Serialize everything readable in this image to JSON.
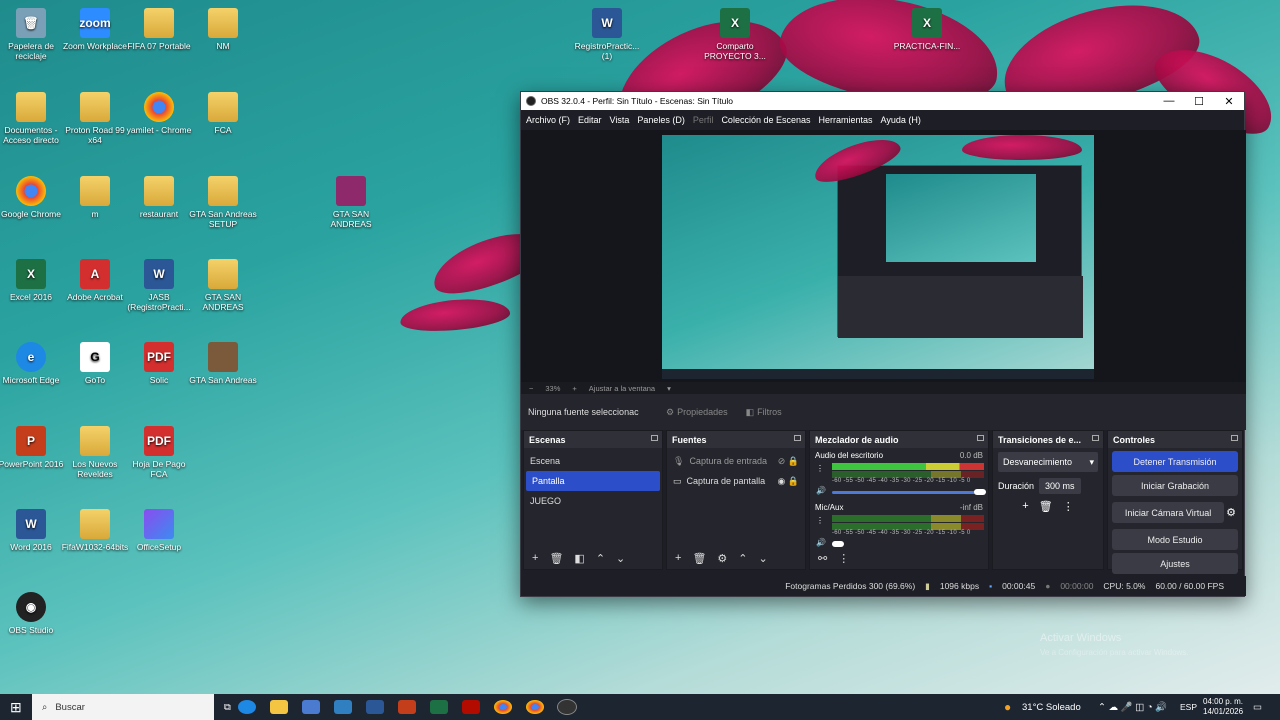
{
  "desktop": {
    "icons": [
      {
        "label": "Papelera de reciclaje",
        "glyph": "🗑",
        "kind": "bin"
      },
      {
        "label": "Zoom Workplace",
        "glyph": "zoom",
        "kind": "zoom"
      },
      {
        "label": "FIFA 07 Portable",
        "glyph": "",
        "kind": "folder"
      },
      {
        "label": "NM",
        "glyph": "",
        "kind": "folder"
      },
      {
        "label": "Documentos - Acceso directo",
        "glyph": "",
        "kind": "folder"
      },
      {
        "label": "Proton Road 99 x64",
        "glyph": "",
        "kind": "folder"
      },
      {
        "label": "yamilet - Chrome",
        "glyph": "",
        "kind": "chrome"
      },
      {
        "label": "FCA",
        "glyph": "",
        "kind": "folder"
      },
      {
        "label": "Google Chrome",
        "glyph": "",
        "kind": "chrome"
      },
      {
        "label": "m",
        "glyph": "",
        "kind": "folder"
      },
      {
        "label": "restaurant",
        "glyph": "",
        "kind": "folder"
      },
      {
        "label": "GTA San Andreas SETUP",
        "glyph": "",
        "kind": "folder"
      },
      {
        "label": "GTA SAN ANDREAS",
        "glyph": "",
        "kind": "rar"
      },
      {
        "label": "Excel 2016",
        "glyph": "X",
        "kind": "xl"
      },
      {
        "label": "Adobe Acrobat",
        "glyph": "A",
        "kind": "pdf"
      },
      {
        "label": "JASB (RegistroPracti...",
        "glyph": "W",
        "kind": "wd"
      },
      {
        "label": "GTA SAN ANDREAS",
        "glyph": "",
        "kind": "folder"
      },
      {
        "label": "Microsoft Edge",
        "glyph": "e",
        "kind": "edge"
      },
      {
        "label": "GoTo",
        "glyph": "G",
        "kind": "goto"
      },
      {
        "label": "Solic",
        "glyph": "PDF",
        "kind": "pdf"
      },
      {
        "label": "GTA San Andreas",
        "glyph": "",
        "kind": "gta"
      },
      {
        "label": "PowerPoint 2016",
        "glyph": "P",
        "kind": "pp"
      },
      {
        "label": "Los Nuevos Reveldes",
        "glyph": "",
        "kind": "folder"
      },
      {
        "label": "Hoja De Pago FCA",
        "glyph": "PDF",
        "kind": "pdf"
      },
      {
        "label": "Word 2016",
        "glyph": "W",
        "kind": "wd"
      },
      {
        "label": "FifaW1032-64bits",
        "glyph": "",
        "kind": "folder"
      },
      {
        "label": "OfficeSetup",
        "glyph": "",
        "kind": "office"
      },
      {
        "label": "OBS Studio",
        "glyph": "◉",
        "kind": "obs"
      },
      {
        "label": "RegistroPractic... (1)",
        "glyph": "W",
        "kind": "wd"
      },
      {
        "label": "Comparto PROYECTO 3...",
        "glyph": "X",
        "kind": "xl"
      },
      {
        "label": "PRACTICA-FIN...",
        "glyph": "X",
        "kind": "xl"
      }
    ]
  },
  "obs": {
    "title": "OBS 32.0.4 - Perfil: Sin Título - Escenas: Sin Título",
    "menu": [
      "Archivo (F)",
      "Editar",
      "Vista",
      "Paneles (D)",
      "Perfil",
      "Colección de Escenas",
      "Herramientas",
      "Ayuda (H)"
    ],
    "zoom": "33%",
    "fit": "Ajustar a la ventana",
    "no_source": "Ninguna fuente seleccionac",
    "properties": "Propiedades",
    "filters": "Filtros",
    "scenes": {
      "title": "Escenas",
      "items": [
        "Escena",
        "Pantalla",
        "JUEGO"
      ],
      "selected": 1
    },
    "sources": {
      "title": "Fuentes",
      "items": [
        "Captura de entrada",
        "Captura de pantalla"
      ]
    },
    "mixer": {
      "title": "Mezclador de audio",
      "channels": [
        {
          "name": "Audio del escritorio",
          "db": "0.0 dB",
          "level": 0.62
        },
        {
          "name": "Mic/Aux",
          "db": "-inf dB",
          "level": 0
        }
      ],
      "ticks": "-60 -55 -50 -45 -40 -35 -30 -25 -20 -15 -10 -5 0"
    },
    "transitions": {
      "title": "Transiciones de e...",
      "type": "Desvanecimiento",
      "duration_label": "Duración",
      "duration": "300 ms"
    },
    "controls": {
      "title": "Controles",
      "buttons": [
        "Detener Transmisión",
        "Iniciar Grabación",
        "Iniciar Cámara Virtual",
        "Modo Estudio",
        "Ajustes"
      ]
    },
    "status": {
      "dropped": "Fotogramas Perdidos 300 (69.6%)",
      "kbps": "1096 kbps",
      "stream_time": "00:00:45",
      "rec_time": "00:00:00",
      "cpu": "CPU: 5.0%",
      "fps": "60.00 / 60.00 FPS"
    }
  },
  "taskbar": {
    "search": "Buscar",
    "weather": "31°C Soleado",
    "lang": "ESP",
    "time": "04:00 p. m.",
    "date": "14/01/2026"
  },
  "watermark": {
    "line1": "Activar Windows",
    "line2": "Ve a Configuración para activar Windows."
  }
}
